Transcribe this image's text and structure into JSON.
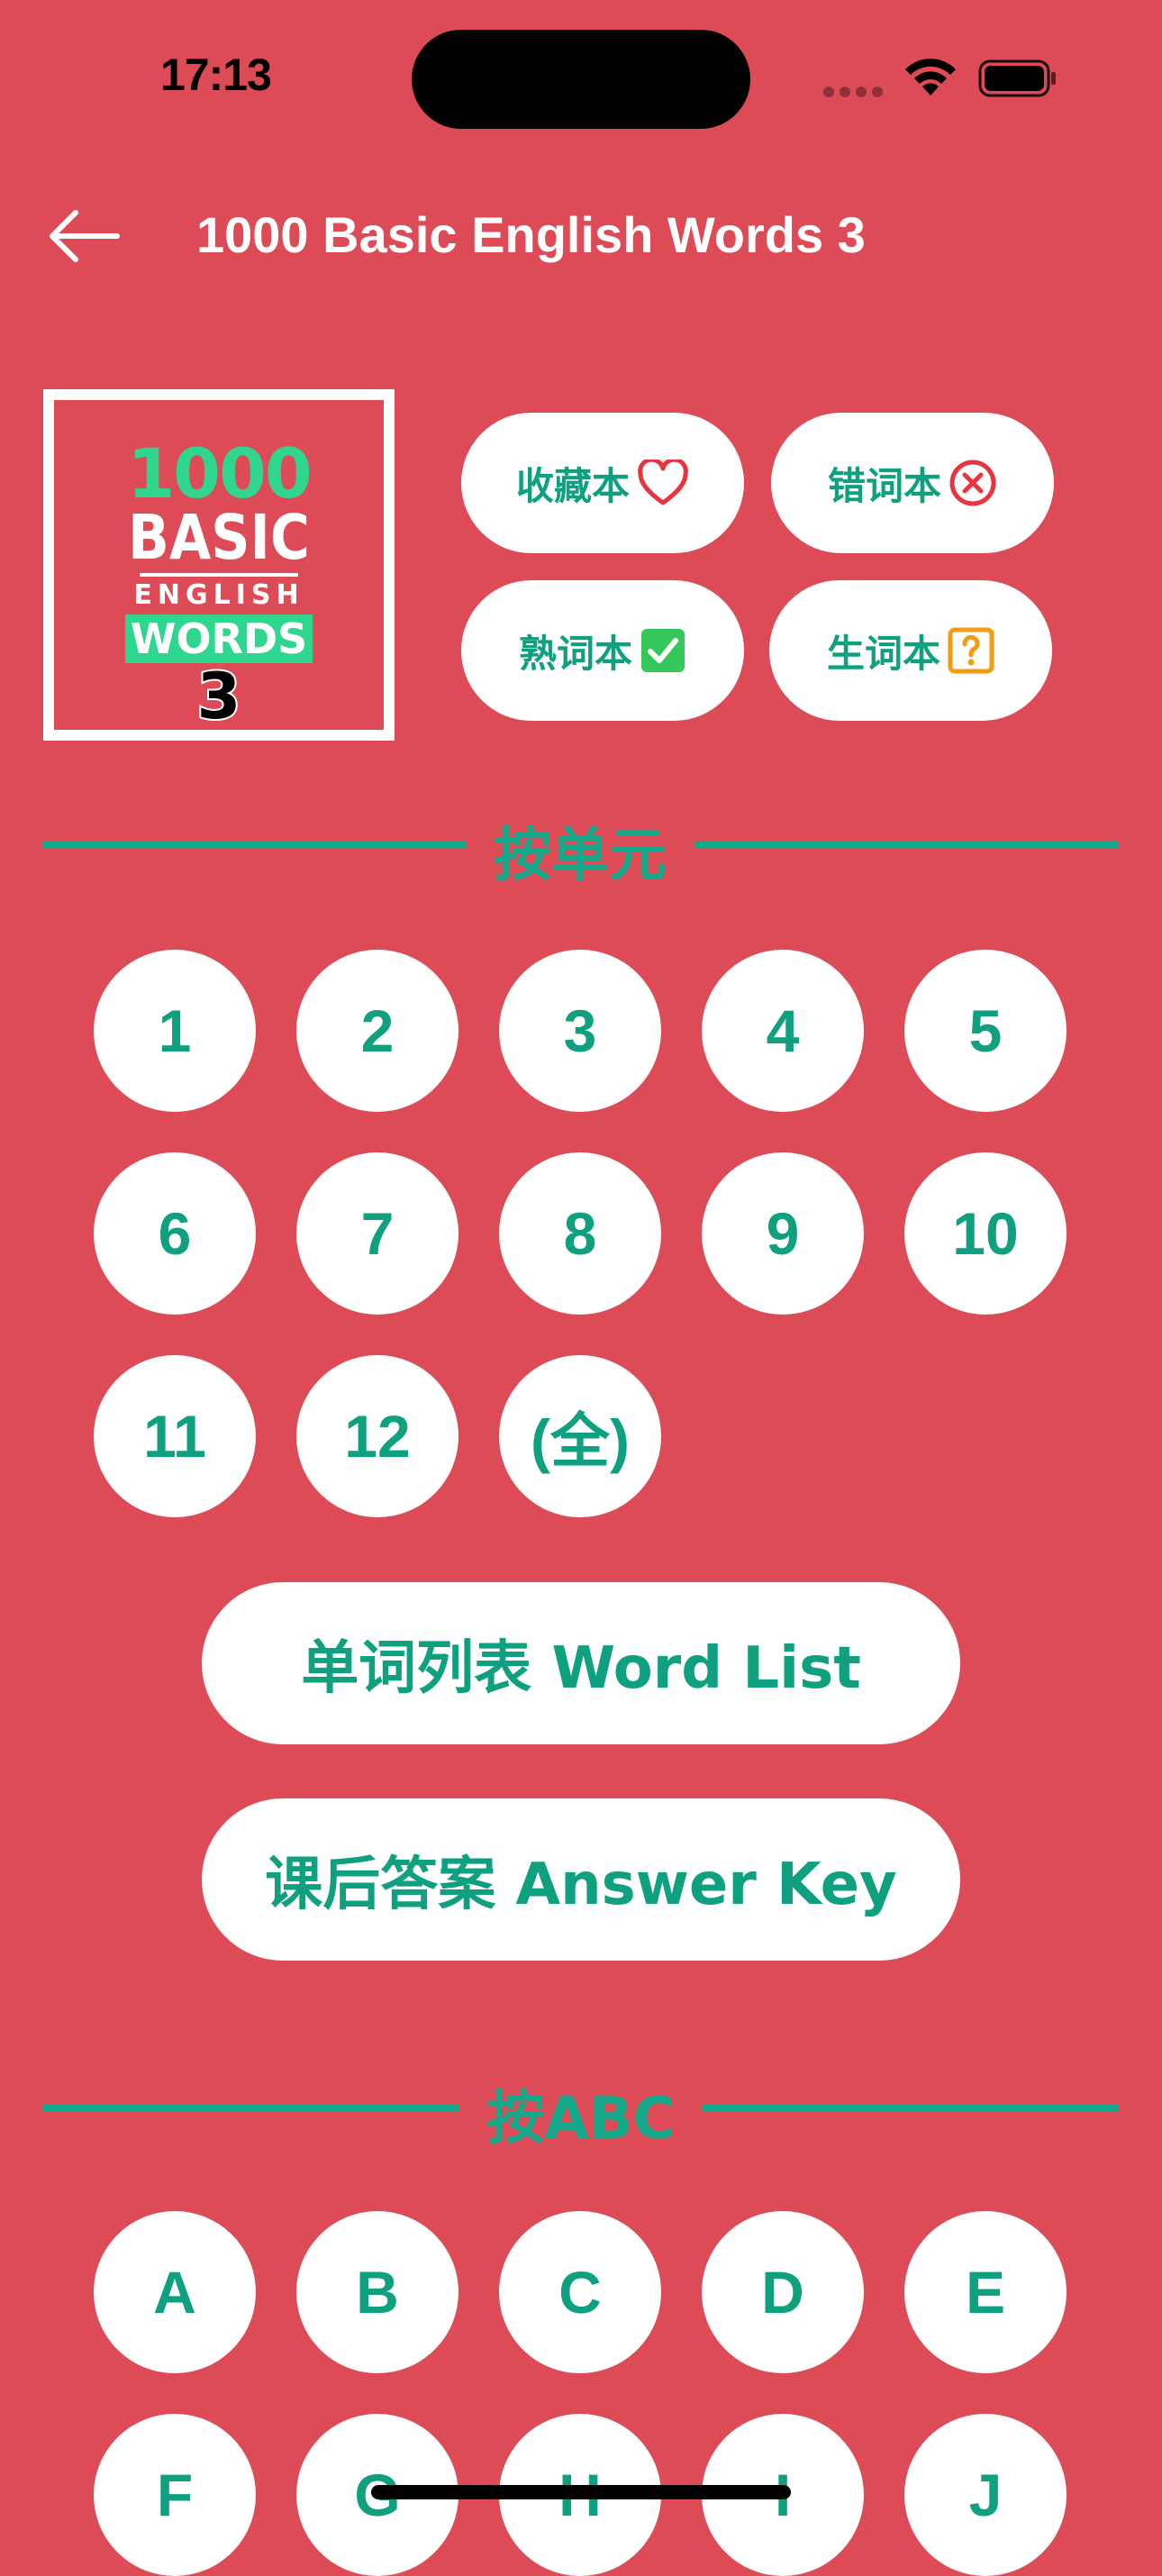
{
  "status_bar": {
    "time": "17:13"
  },
  "nav": {
    "title": "1000 Basic English Words 3",
    "back_icon": "arrow-left-icon"
  },
  "cover": {
    "line1": "1000",
    "line2": "BASIC",
    "line3": "ENGLISH",
    "line4": "WORDS",
    "line5": "3"
  },
  "word_books": [
    {
      "label": "收藏本",
      "icon": "heart-icon"
    },
    {
      "label": "错词本",
      "icon": "x-circle-icon"
    },
    {
      "label": "熟词本",
      "icon": "checkmark-box-icon"
    },
    {
      "label": "生词本",
      "icon": "question-box-icon"
    }
  ],
  "sections": {
    "by_unit": "按单元",
    "by_abc": "按ABC"
  },
  "units": [
    "1",
    "2",
    "3",
    "4",
    "5",
    "6",
    "7",
    "8",
    "9",
    "10",
    "11",
    "12",
    "(全)"
  ],
  "actions": {
    "word_list": "单词列表 Word List",
    "answer_key": "课后答案 Answer Key"
  },
  "letters": [
    "A",
    "B",
    "C",
    "D",
    "E",
    "F",
    "G",
    "H",
    "I",
    "J"
  ],
  "colors": {
    "background": "#DC4B56",
    "accent": "#0FA07F",
    "cover_green": "#2ED68E"
  }
}
